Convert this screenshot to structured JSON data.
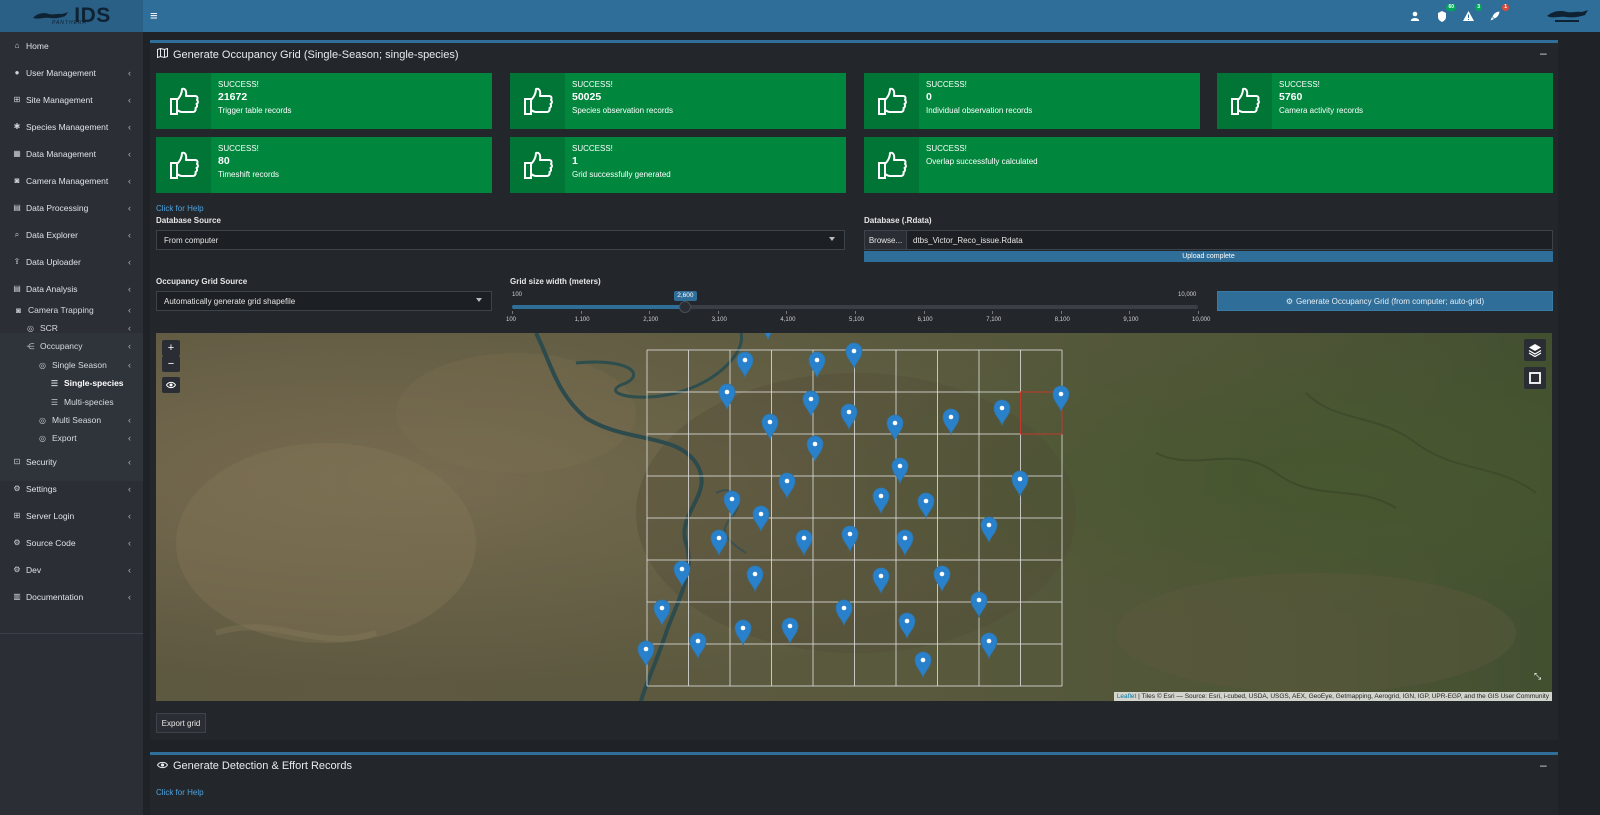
{
  "header": {
    "brand": "IDS",
    "brand_sub": "PANTHERA",
    "notification_badges": {
      "tasks": "60",
      "alerts": "3",
      "messages": "1"
    }
  },
  "sidebar": {
    "items": [
      {
        "label": "Home",
        "icon": "home-icon"
      },
      {
        "label": "User Management",
        "icon": "user-icon"
      },
      {
        "label": "Site Management",
        "icon": "sitemap-icon"
      },
      {
        "label": "Species Management",
        "icon": "paw-icon"
      },
      {
        "label": "Data Management",
        "icon": "table-icon"
      },
      {
        "label": "Camera Management",
        "icon": "camera-icon"
      },
      {
        "label": "Data Processing",
        "icon": "database-icon"
      },
      {
        "label": "Data Explorer",
        "icon": "search-icon"
      },
      {
        "label": "Data Uploader",
        "icon": "upload-icon"
      },
      {
        "label": "Data Analysis",
        "icon": "database-icon"
      }
    ],
    "subtree": [
      {
        "label": "Camera Trapping",
        "icon": "camera-icon"
      },
      {
        "label": "SCR",
        "icon": "circle-icon"
      },
      {
        "label": "Occupancy",
        "icon": "share-icon"
      },
      {
        "label": "Single Season",
        "icon": "circle-icon"
      },
      {
        "label": "Single-species",
        "icon": "list-icon"
      },
      {
        "label": "Multi-species",
        "icon": "list-icon"
      },
      {
        "label": "Multi Season",
        "icon": "circle-icon"
      },
      {
        "label": "Export",
        "icon": "circle-icon"
      }
    ],
    "bottom_items": [
      {
        "label": "Security",
        "icon": "lock-icon"
      },
      {
        "label": "Settings",
        "icon": "gear-icon"
      },
      {
        "label": "Server Login",
        "icon": "server-icon"
      },
      {
        "label": "Source Code",
        "icon": "gears-icon"
      },
      {
        "label": "Dev",
        "icon": "gears-icon"
      },
      {
        "label": "Documentation",
        "icon": "book-icon"
      }
    ]
  },
  "occupancy_box": {
    "title": "Generate Occupancy Grid (Single-Season; single-species)",
    "collapse": "–"
  },
  "info_boxes": [
    {
      "label": "SUCCESS!",
      "number": "21672",
      "desc": "Trigger table records"
    },
    {
      "label": "SUCCESS!",
      "number": "50025",
      "desc": "Species observation records"
    },
    {
      "label": "SUCCESS!",
      "number": "0",
      "desc": "Individual observation records"
    },
    {
      "label": "SUCCESS!",
      "number": "5760",
      "desc": "Camera activity records"
    },
    {
      "label": "SUCCESS!",
      "number": "80",
      "desc": "Timeshift records"
    },
    {
      "label": "SUCCESS!",
      "number": "1",
      "desc": "Grid successfully generated"
    },
    {
      "label": "SUCCESS!",
      "number": "",
      "desc": "Overlap successfully calculated"
    }
  ],
  "form": {
    "help_link": "Click for Help",
    "db_source_label": "Database Source",
    "db_source_value": "From computer",
    "db_file_label": "Database (.Rdata)",
    "browse_label": "Browse...",
    "file_name": "dtbs_Victor_Reco_issue.Rdata",
    "upload_status": "Upload complete",
    "grid_source_label": "Occupancy Grid Source",
    "grid_source_value": "Automatically generate grid shapefile",
    "grid_size_label": "Grid size width (meters)",
    "slider_min": "100",
    "slider_max": "10,000",
    "slider_value": "2,600",
    "slider_value_num": 2600,
    "slider_ticks": [
      "100",
      "1,100",
      "2,100",
      "3,100",
      "4,100",
      "5,100",
      "6,100",
      "7,100",
      "8,100",
      "9,100",
      "10,000"
    ],
    "generate_button": "Generate Occupancy Grid (from computer; auto-grid)"
  },
  "map": {
    "zoom_in": "+",
    "zoom_out": "−",
    "attribution_link": "Leaflet",
    "attribution_text": " | Tiles © Esri — Source: Esri, i-cubed, USDA, USGS, AEX, GeoEye, Getmapping, Aerogrid, IGN, IGP, UPR-EGP, and the GIS User Community"
  },
  "export_button": "Export grid",
  "detection_box": {
    "title": "Generate Detection & Effort Records",
    "collapse": "–",
    "help_link": "Click for Help"
  },
  "colors": {
    "header": "#2f6e98",
    "success_green": "#00863d",
    "sidebar": "#2b2f35",
    "content_bg": "#1f2226"
  }
}
